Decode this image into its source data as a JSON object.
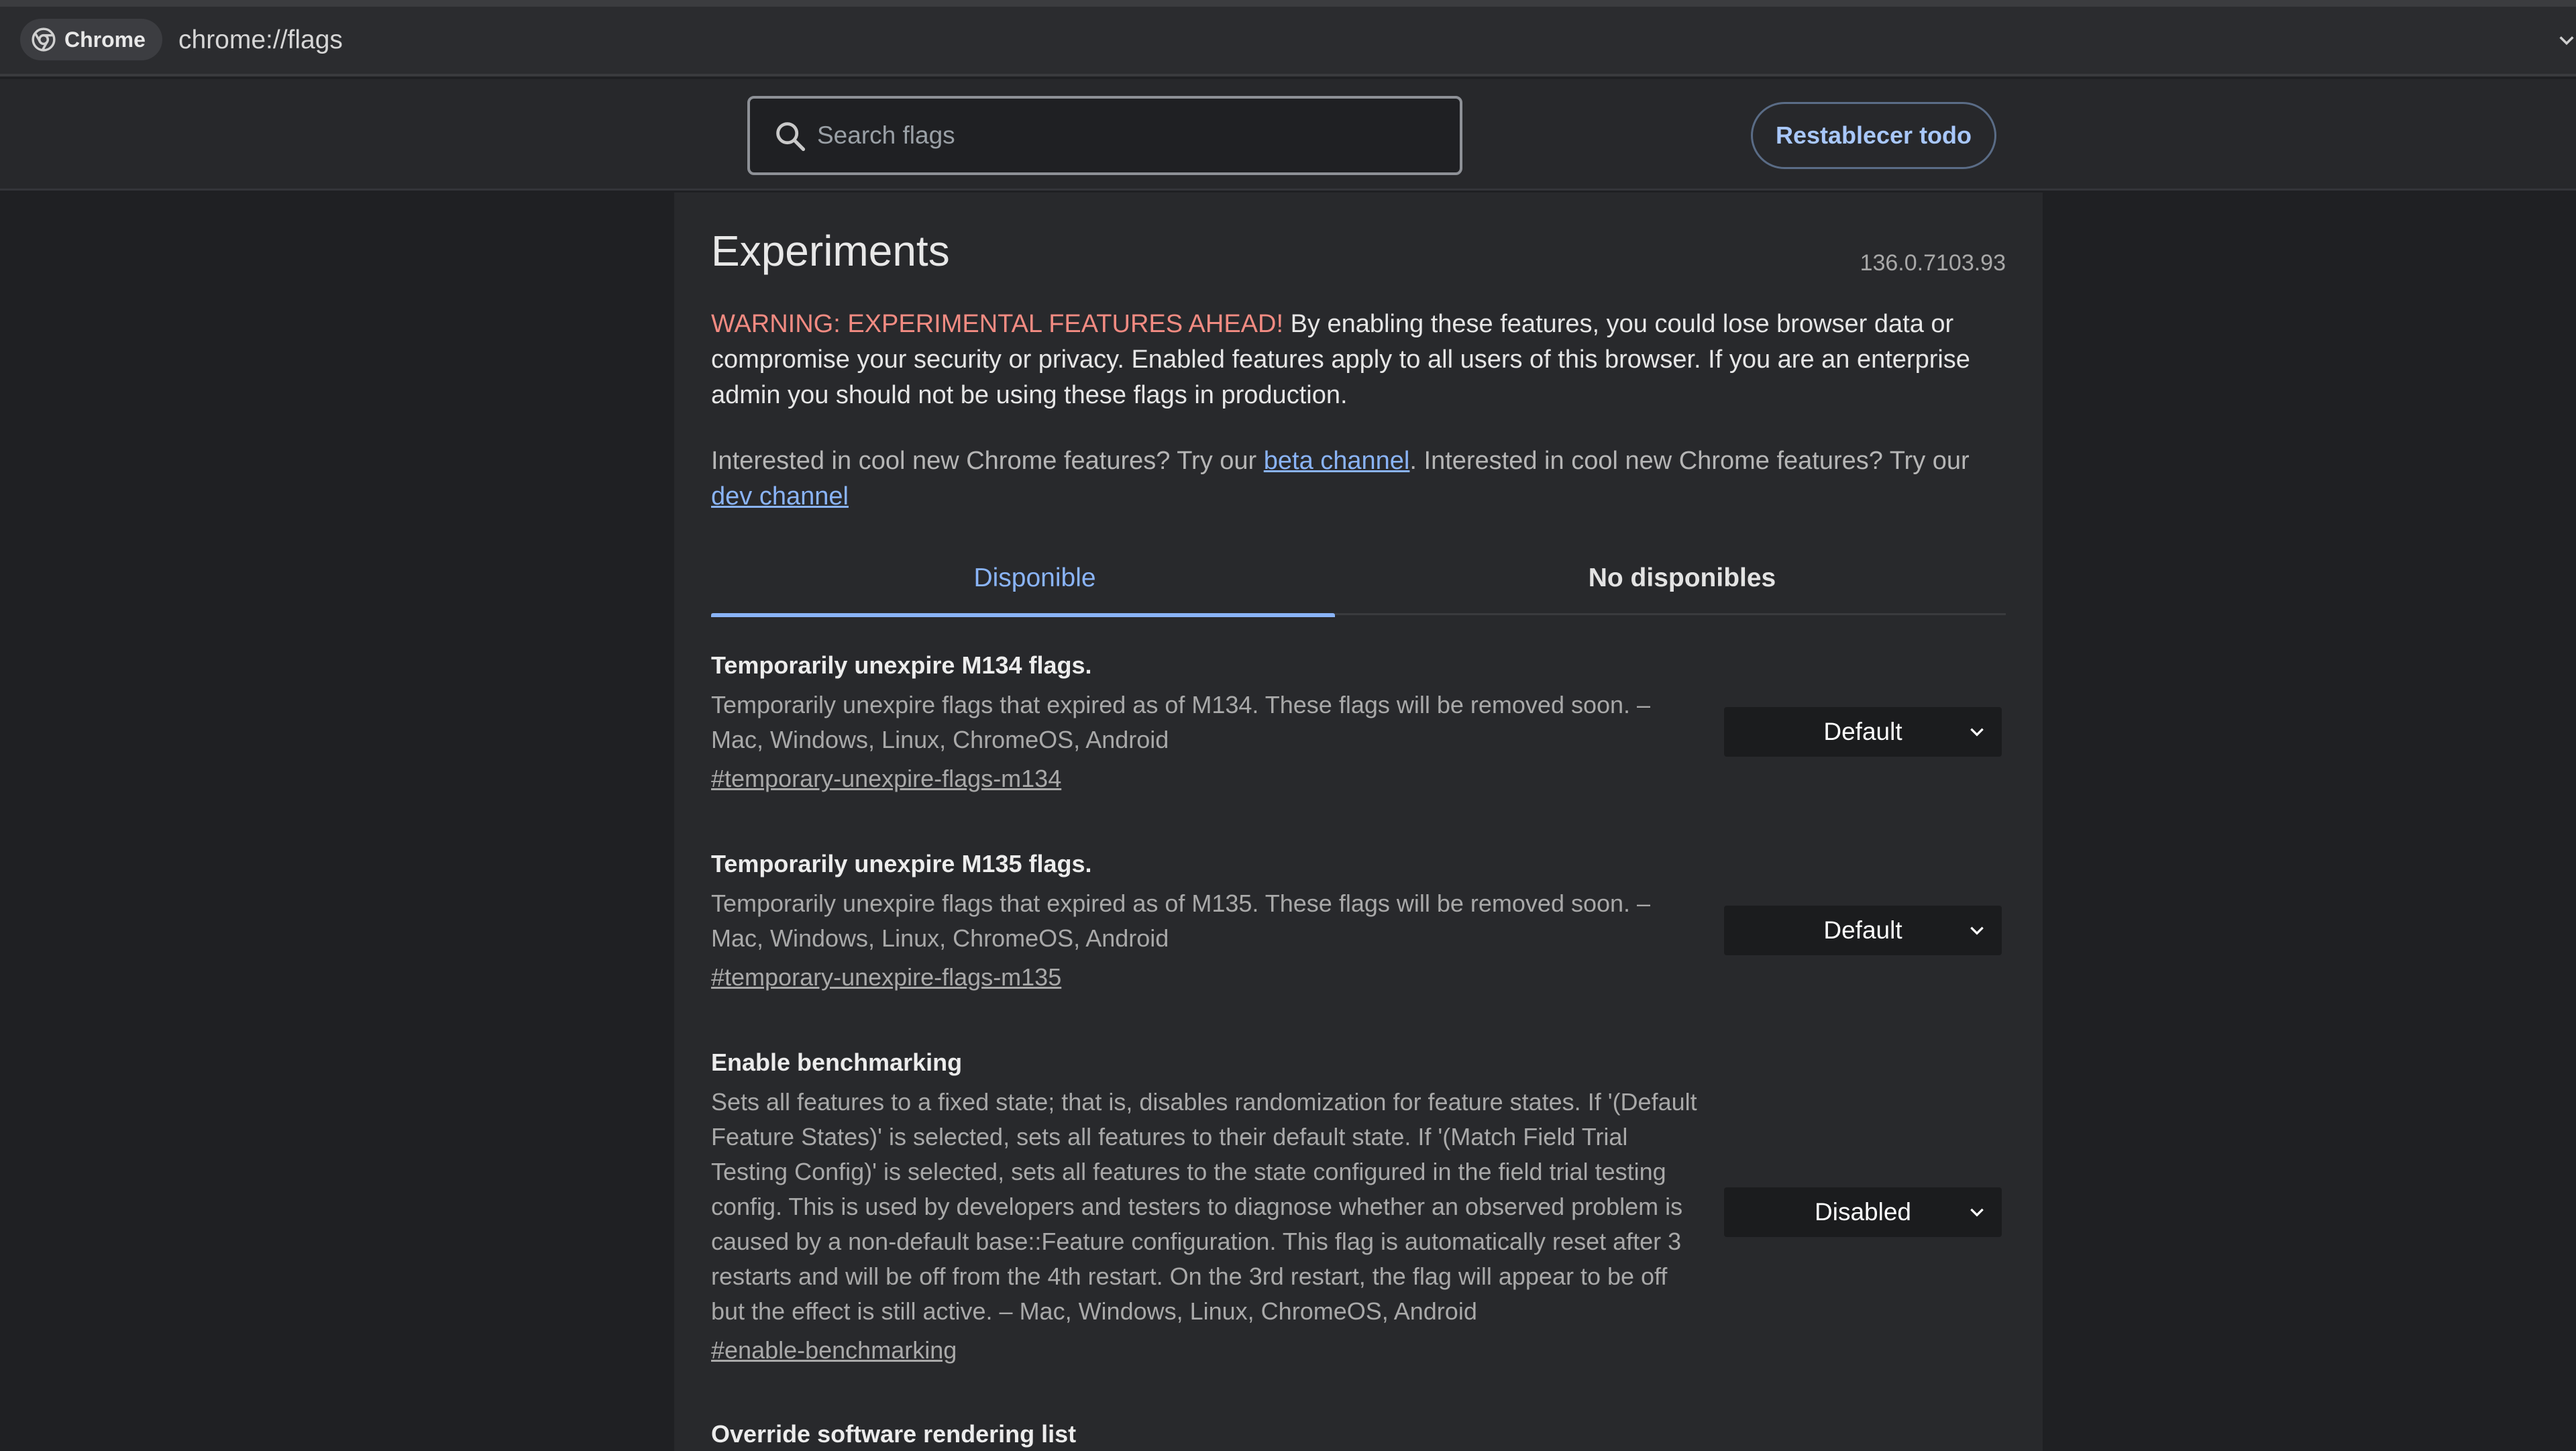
{
  "browser": {
    "chip_label": "Chrome",
    "url": "chrome://flags"
  },
  "header": {
    "search_placeholder": "Search flags",
    "reset_label": "Restablecer todo"
  },
  "page": {
    "title": "Experiments",
    "version": "136.0.7103.93",
    "warning_prefix": "WARNING: EXPERIMENTAL FEATURES AHEAD!",
    "warning_text": " By enabling these features, you could lose browser data or compromise your security or privacy. Enabled features apply to all users of this browser. If you are an enterprise admin you should not be using these flags in production.",
    "channels_text_1": "Interested in cool new Chrome features? Try our ",
    "beta_link": "beta channel",
    "channels_text_2": ". Interested in cool new Chrome features? Try our ",
    "dev_link": "dev channel"
  },
  "tabs": {
    "available": "Disponible",
    "unavailable": "No disponibles"
  },
  "flags": [
    {
      "name": "Temporarily unexpire M134 flags.",
      "description": "Temporarily unexpire flags that expired as of M134. These flags will be removed soon. – Mac, Windows, Linux, ChromeOS, Android",
      "anchor": "#temporary-unexpire-flags-m134",
      "value": "Default"
    },
    {
      "name": "Temporarily unexpire M135 flags.",
      "description": "Temporarily unexpire flags that expired as of M135. These flags will be removed soon. – Mac, Windows, Linux, ChromeOS, Android",
      "anchor": "#temporary-unexpire-flags-m135",
      "value": "Default"
    },
    {
      "name": "Enable benchmarking",
      "description": "Sets all features to a fixed state; that is, disables randomization for feature states. If '(Default Feature States)' is selected, sets all features to their default state. If '(Match Field Trial Testing Config)' is selected, sets all features to the state configured in the field trial testing config. This is used by developers and testers to diagnose whether an observed problem is caused by a non-default base::Feature configuration. This flag is automatically reset after 3 restarts and will be off from the 4th restart. On the 3rd restart, the flag will appear to be off but the effect is still active. – Mac, Windows, Linux, ChromeOS, Android",
      "anchor": "#enable-benchmarking",
      "value": "Disabled"
    },
    {
      "name": "Override software rendering list"
    }
  ]
}
